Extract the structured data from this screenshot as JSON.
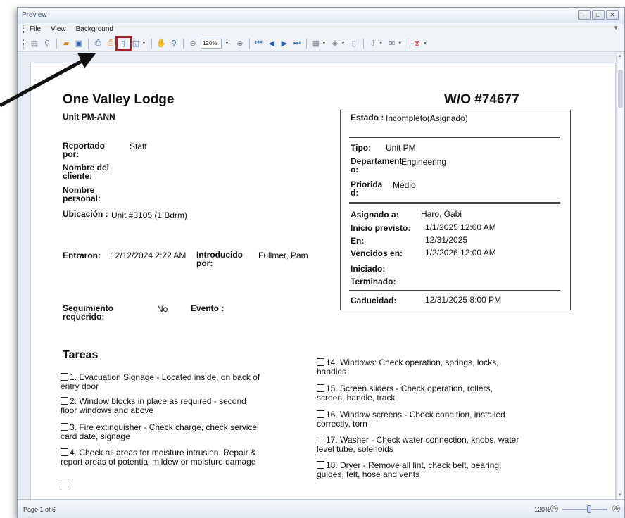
{
  "window": {
    "title": "Preview"
  },
  "menu": {
    "items": [
      "File",
      "View",
      "Background"
    ]
  },
  "toolbar": {
    "zoom_value": "120%"
  },
  "status": {
    "page_indicator": "Page 1 of 6",
    "zoom_label": "120%",
    "minus": "⊖",
    "plus": "⊕",
    "zoom_fraction": 0.6
  },
  "report": {
    "property": "One Valley Lodge",
    "wo": "W/O #74677",
    "unit": "Unit PM-ANN",
    "reported_by_label": "Reportado por:",
    "reported_by_value": "Staff",
    "client_name_label": "Nombre del cliente:",
    "personal_name_label": "Nombre personal:",
    "location_label": "Ubicación :",
    "location_value": "Unit #3105 (1 Bdrm)",
    "entered_label": "Entraron:",
    "entered_value": "12/12/2024 2:22 AM",
    "introduced_label": "Introducido por:",
    "introduced_value": "Fullmer, Pam",
    "followup_label": "Seguimiento requerido:",
    "followup_value": "No",
    "event_label": "Evento :",
    "status_label": "Estado :",
    "status_value": "Incompleto(Asignado)",
    "type_label": "Tipo:",
    "type_value": "Unit PM",
    "department_label": "Departament o:",
    "department_value": "Engineering",
    "priority_label": "Priorida d:",
    "priority_value": "Medio",
    "assigned_label": "Asignado a:",
    "assigned_value": "Haro, Gabi",
    "start_label": "Inicio previsto:",
    "start_value": "1/1/2025 12:00 AM",
    "en_label": "En:",
    "en_value": "12/31/2025",
    "due_label": "Vencidos en:",
    "due_value": "1/2/2026 12:00 AM",
    "started_label": "Iniciado:",
    "finished_label": "Terminado:",
    "expiry_label": "Caducidad:",
    "expiry_value": "12/31/2025 8:00 PM",
    "tasks_heading": "Tareas",
    "tasks_left": [
      "1. Evacuation Signage - Located inside, on back of entry door",
      "2. Window blocks in place as required - second floor windows and above",
      "3. Fire extinguisher - Check charge, check service card date, signage",
      "4. Check all areas for moisture intrusion. Repair & report areas of potential mildew or moisture damage"
    ],
    "tasks_right": [
      "14. Windows: Check operation, springs, locks, handles",
      "15. Screen sliders - Check operation, rollers, screen, handle, track",
      "16. Window screens - Check condition, installed correctly, torn",
      "17. Washer - Check water connection, knobs, water level tube, solenoids",
      "18. Dryer - Remove all lint, check belt, bearing, guides, felt, hose and vents"
    ]
  }
}
